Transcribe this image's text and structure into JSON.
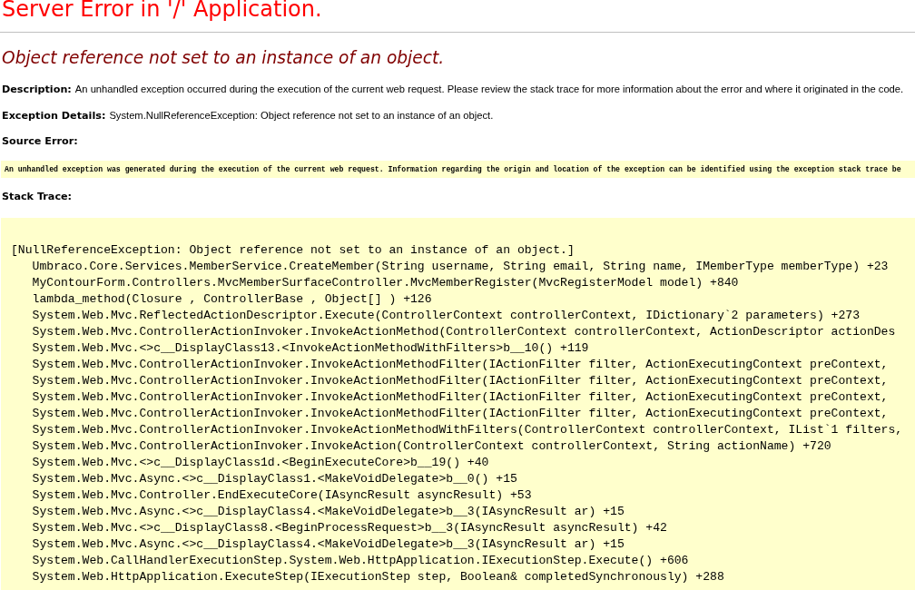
{
  "title": "Server Error in '/' Application.",
  "message": "Object reference not set to an instance of an object.",
  "description": {
    "label": "Description:",
    "text": "An unhandled exception occurred during the execution of the current web request. Please review the stack trace for more information about the error and where it originated in the code."
  },
  "exception_details": {
    "label": "Exception Details:",
    "text": "System.NullReferenceException: Object reference not set to an instance of an object."
  },
  "source_error": {
    "label": "Source Error:",
    "text": "An unhandled exception was generated during the execution of the current web request. Information regarding the origin and location of the exception can be identified using the exception stack trace be"
  },
  "stack_trace": {
    "label": "Stack Trace:",
    "exception": "[NullReferenceException: Object reference not set to an instance of an object.]",
    "frames": [
      "Umbraco.Core.Services.MemberService.CreateMember(String username, String email, String name, IMemberType memberType) +23",
      "MyContourForm.Controllers.MvcMemberSurfaceController.MvcMemberRegister(MvcRegisterModel model) +840",
      "lambda_method(Closure , ControllerBase , Object[] ) +126",
      "System.Web.Mvc.ReflectedActionDescriptor.Execute(ControllerContext controllerContext, IDictionary`2 parameters) +273",
      "System.Web.Mvc.ControllerActionInvoker.InvokeActionMethod(ControllerContext controllerContext, ActionDescriptor actionDes",
      "System.Web.Mvc.<>c__DisplayClass13.<InvokeActionMethodWithFilters>b__10() +119",
      "System.Web.Mvc.ControllerActionInvoker.InvokeActionMethodFilter(IActionFilter filter, ActionExecutingContext preContext,",
      "System.Web.Mvc.ControllerActionInvoker.InvokeActionMethodFilter(IActionFilter filter, ActionExecutingContext preContext,",
      "System.Web.Mvc.ControllerActionInvoker.InvokeActionMethodFilter(IActionFilter filter, ActionExecutingContext preContext,",
      "System.Web.Mvc.ControllerActionInvoker.InvokeActionMethodFilter(IActionFilter filter, ActionExecutingContext preContext,",
      "System.Web.Mvc.ControllerActionInvoker.InvokeActionMethodWithFilters(ControllerContext controllerContext, IList`1 filters,",
      "System.Web.Mvc.ControllerActionInvoker.InvokeAction(ControllerContext controllerContext, String actionName) +720",
      "System.Web.Mvc.<>c__DisplayClass1d.<BeginExecuteCore>b__19() +40",
      "System.Web.Mvc.Async.<>c__DisplayClass1.<MakeVoidDelegate>b__0() +15",
      "System.Web.Mvc.Controller.EndExecuteCore(IAsyncResult asyncResult) +53",
      "System.Web.Mvc.Async.<>c__DisplayClass4.<MakeVoidDelegate>b__3(IAsyncResult ar) +15",
      "System.Web.Mvc.<>c__DisplayClass8.<BeginProcessRequest>b__3(IAsyncResult asyncResult) +42",
      "System.Web.Mvc.Async.<>c__DisplayClass4.<MakeVoidDelegate>b__3(IAsyncResult ar) +15",
      "System.Web.CallHandlerExecutionStep.System.Web.HttpApplication.IExecutionStep.Execute() +606",
      "System.Web.HttpApplication.ExecuteStep(IExecutionStep step, Boolean& completedSynchronously) +288"
    ]
  }
}
